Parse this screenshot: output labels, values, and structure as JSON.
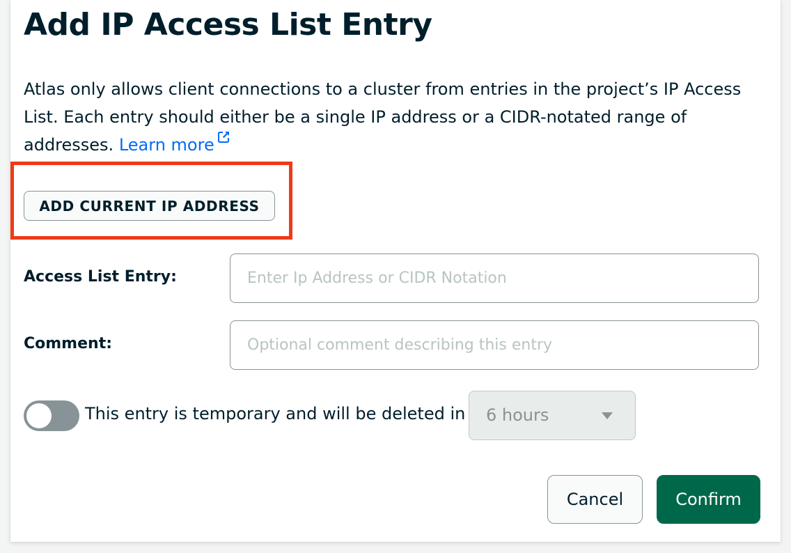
{
  "dialog": {
    "title": "Add IP Access List Entry",
    "description": "Atlas only allows client connections to a cluster from entries in the project’s IP Access List. Each entry should either be a single IP address or a CIDR-notated range of addresses.",
    "learn_more_label": "Learn more",
    "learn_more_icon": "external-link-icon",
    "add_current_ip_label": "ADD CURRENT IP ADDRESS",
    "highlight_color": "#f03a17"
  },
  "form": {
    "access_list_entry": {
      "label": "Access List Entry:",
      "value": "",
      "placeholder": "Enter Ip Address or CIDR Notation"
    },
    "comment": {
      "label": "Comment:",
      "value": "",
      "placeholder": "Optional comment describing this entry"
    },
    "temporary": {
      "enabled": false,
      "label": "This entry is temporary and will be deleted in",
      "duration": "6 hours"
    }
  },
  "actions": {
    "cancel_label": "Cancel",
    "confirm_label": "Confirm"
  },
  "colors": {
    "text": "#001e2b",
    "link": "#016bf8",
    "primary": "#00684a",
    "border": "#889397"
  }
}
